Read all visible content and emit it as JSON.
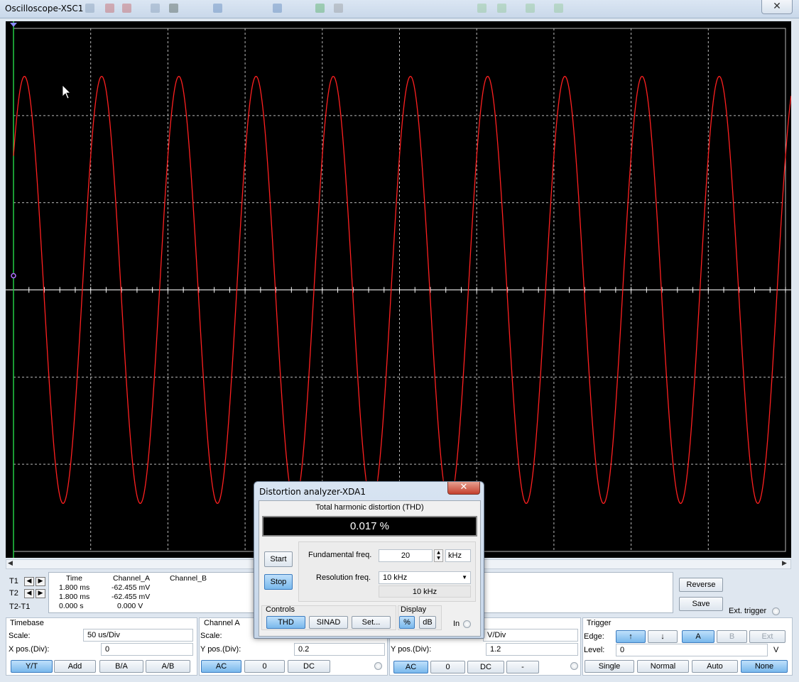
{
  "window": {
    "title": "Oscilloscope-XSC1",
    "close_symbol": "✕"
  },
  "cursor_readout": {
    "header": {
      "time": "Time",
      "channel_a": "Channel_A",
      "channel_b": "Channel_B"
    },
    "rows": [
      {
        "label": "T1",
        "time": "1.800 ms",
        "channel_a": "-62.455 mV",
        "channel_b": ""
      },
      {
        "label": "T2",
        "time": "1.800 ms",
        "channel_a": "-62.455 mV",
        "channel_b": ""
      },
      {
        "label": "T2-T1",
        "time": "0.000 s",
        "channel_a": "0.000 V",
        "channel_b": ""
      }
    ]
  },
  "side_buttons": {
    "reverse": "Reverse",
    "save": "Save",
    "ext_trigger": "Ext. trigger"
  },
  "timebase": {
    "title": "Timebase",
    "scale_label": "Scale:",
    "scale_value": "50 us/Div",
    "xpos_label": "X pos.(Div):",
    "xpos_value": "0",
    "modes": [
      "Y/T",
      "Add",
      "B/A",
      "A/B"
    ],
    "selected_mode": "Y/T"
  },
  "channel_a": {
    "title": "Channel A",
    "scale_label": "Scale:",
    "ypos_label": "Y pos.(Div):",
    "ypos_value": "0.2",
    "couplings": [
      "AC",
      "0",
      "DC"
    ],
    "selected_coupling": "AC"
  },
  "channel_b": {
    "scale_value_partial": "V/Div",
    "ypos_label": "Y pos.(Div):",
    "ypos_value": "1.2",
    "couplings": [
      "AC",
      "0",
      "DC",
      "-"
    ],
    "selected_coupling": "AC"
  },
  "trigger": {
    "title": "Trigger",
    "edge_label": "Edge:",
    "edge_rising": "↑",
    "edge_falling": "↓",
    "sources": [
      "A",
      "B",
      "Ext"
    ],
    "selected_source": "A",
    "level_label": "Level:",
    "level_value": "0",
    "level_unit": "V",
    "modes": [
      "Single",
      "Normal",
      "Auto",
      "None"
    ],
    "selected_mode": "None"
  },
  "distortion_analyzer": {
    "title": "Distortion analyzer-XDA1",
    "close_symbol": "✕",
    "heading": "Total harmonic distortion (THD)",
    "value": "0.017 %",
    "start": "Start",
    "stop": "Stop",
    "fundamental_label": "Fundamental freq.",
    "fundamental_value": "20",
    "fundamental_unit": "kHz",
    "resolution_label": "Resolution freq.",
    "resolution_value": "10 kHz",
    "resolution_readout": "10 kHz",
    "controls_title": "Controls",
    "controls": [
      "THD",
      "SINAD",
      "Set..."
    ],
    "selected_control": "THD",
    "display_title": "Display",
    "display_modes": [
      "%",
      "dB"
    ],
    "selected_display": "%",
    "in_label": "In"
  },
  "colors": {
    "trace_a": "#ff2020",
    "screen_bg": "#000000",
    "grid": "#b8b8b8",
    "axis": "#ffffff",
    "cursor_t1": "#22cc44",
    "active_button": "#79b8ec"
  },
  "waveform": {
    "channel": "A",
    "cycles_on_screen": 10,
    "peak_div": 2.45
  }
}
